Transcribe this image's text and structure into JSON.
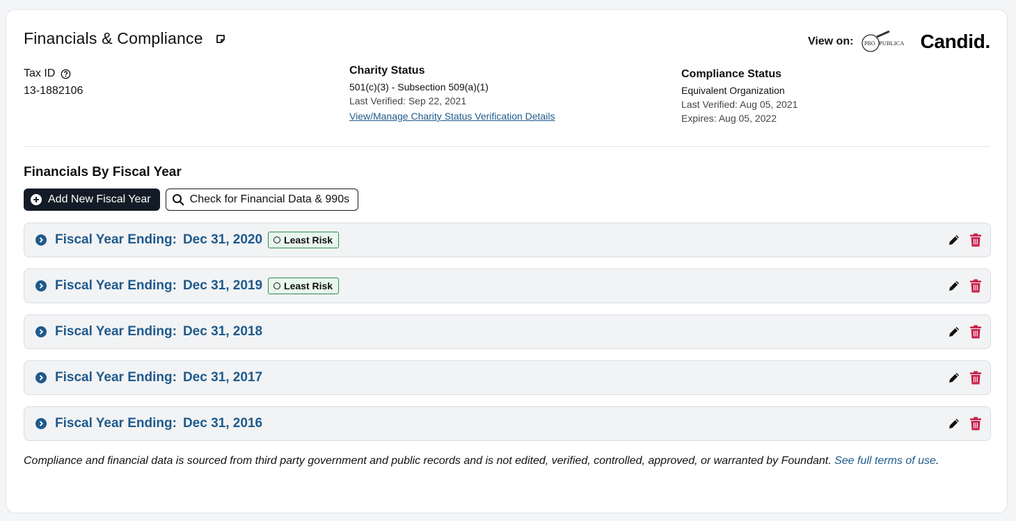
{
  "header": {
    "title": "Financials & Compliance",
    "view_on_label": "View on:",
    "propublica_logo": "PROPUBLICA",
    "candid_logo": "Candid."
  },
  "tax": {
    "label": "Tax ID",
    "value": "13-1882106"
  },
  "charity": {
    "heading": "Charity Status",
    "status": "501(c)(3) - Subsection 509(a)(1)",
    "verified": "Last Verified: Sep 22, 2021",
    "link": "View/Manage Charity Status Verification Details"
  },
  "compliance": {
    "heading": "Compliance Status",
    "status": "Equivalent Organization",
    "verified": "Last Verified: Aug 05, 2021",
    "expires": "Expires: Aug 05, 2022"
  },
  "financials": {
    "section_title": "Financials By Fiscal Year",
    "add_button": "Add New Fiscal Year",
    "check_button": "Check for Financial Data & 990s",
    "rows": [
      {
        "label": "Fiscal Year Ending:",
        "date": "Dec 31, 2020",
        "badge": "Least Risk"
      },
      {
        "label": "Fiscal Year Ending:",
        "date": "Dec 31, 2019",
        "badge": "Least Risk"
      },
      {
        "label": "Fiscal Year Ending:",
        "date": "Dec 31, 2018",
        "badge": ""
      },
      {
        "label": "Fiscal Year Ending:",
        "date": "Dec 31, 2017",
        "badge": ""
      },
      {
        "label": "Fiscal Year Ending:",
        "date": "Dec 31, 2016",
        "badge": ""
      }
    ]
  },
  "footer": {
    "text": "Compliance and financial data is sourced from third party government and public records and is not edited, verified, controlled, approved, or warranted by Foundant. ",
    "link": "See full terms of use",
    "end": "."
  },
  "colors": {
    "accent_blue": "#1e5a8c",
    "dark_button": "#131c26",
    "badge_green": "#2d8a4f",
    "trash_red": "#c8234b"
  }
}
